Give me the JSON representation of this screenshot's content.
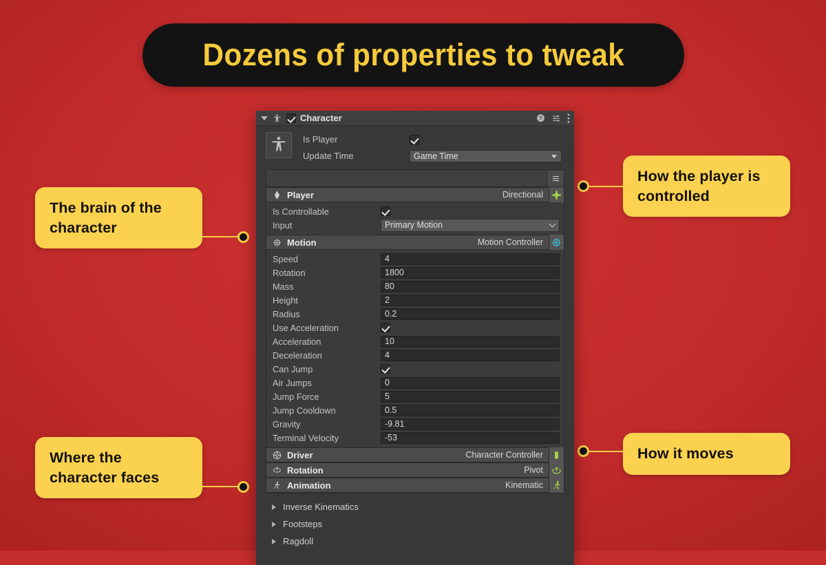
{
  "banner": {
    "title": "Dozens of properties to tweak"
  },
  "colors": {
    "background_red": "#c62d2d",
    "banner_bg": "#131313",
    "banner_text": "#f5ca3c",
    "callout_bg": "#fad24f",
    "callout_text": "#15110c",
    "leader_line": "#f8cf48",
    "panel_bg": "#383838",
    "accent_green": "#a8d14a",
    "accent_cyan": "#3fc5e0"
  },
  "callouts": [
    {
      "id": "brain",
      "text": "The brain of the character"
    },
    {
      "id": "controlled",
      "text": "How the player is controlled"
    },
    {
      "id": "faces",
      "text": "Where the character faces"
    },
    {
      "id": "moves",
      "text": "How it moves"
    }
  ],
  "inspector": {
    "header": {
      "foldout_icon": "triangle-down-icon",
      "component_icon": "character-person-icon",
      "enabled": true,
      "title": "Character",
      "icons": [
        "help-icon",
        "preset-sliders-icon",
        "more-menu-icon"
      ]
    },
    "script_thumbnail_icon": "character-person-icon",
    "top_fields": [
      {
        "label": "Is Player",
        "type": "checkbox",
        "value": true
      },
      {
        "label": "Update Time",
        "type": "dropdown",
        "value": "Game Time"
      }
    ],
    "nested_toolbar_icon": "preset-sliders-icon",
    "sections": [
      {
        "id": "player",
        "icon": "diamond-icon",
        "name": "Player",
        "value": "Directional",
        "badge_icon": "dpad-move-icon",
        "badge_color": "#a8d14a",
        "rows": [
          {
            "label": "Is Controllable",
            "type": "checkbox",
            "value": true
          },
          {
            "label": "Input",
            "type": "dropdown",
            "value": "Primary Motion"
          }
        ]
      },
      {
        "id": "motion",
        "icon": "gear-chip-icon",
        "name": "Motion",
        "value": "Motion Controller",
        "badge_icon": "gear-chip-icon",
        "badge_color": "#3fc5e0",
        "rows": [
          {
            "label": "Speed",
            "type": "text",
            "value": "4"
          },
          {
            "label": "Rotation",
            "type": "text",
            "value": "1800"
          },
          {
            "label": "Mass",
            "type": "text",
            "value": "80"
          },
          {
            "label": "Height",
            "type": "text",
            "value": "2"
          },
          {
            "label": "Radius",
            "type": "text",
            "value": "0.2"
          },
          {
            "label": "Use Acceleration",
            "type": "checkbox",
            "value": true
          },
          {
            "label": "Acceleration",
            "type": "text",
            "value": "10"
          },
          {
            "label": "Deceleration",
            "type": "text",
            "value": "4"
          },
          {
            "label": "Can Jump",
            "type": "checkbox",
            "value": true
          },
          {
            "label": "Air Jumps",
            "type": "text",
            "value": "0"
          },
          {
            "label": "Jump Force",
            "type": "text",
            "value": "5"
          },
          {
            "label": "Jump Cooldown",
            "type": "text",
            "value": "0.5"
          },
          {
            "label": "Gravity",
            "type": "text",
            "value": "-9.81"
          },
          {
            "label": "Terminal Velocity",
            "type": "text",
            "value": "-53"
          }
        ]
      },
      {
        "id": "driver",
        "icon": "wheel-icon",
        "name": "Driver",
        "value": "Character Controller",
        "badge_icon": "capsule-icon",
        "badge_color": "#a8d14a",
        "rows": []
      },
      {
        "id": "rotation",
        "icon": "rotate-icon",
        "name": "Rotation",
        "value": "Pivot",
        "badge_icon": "rotate-icon",
        "badge_color": "#a8d14a",
        "rows": []
      },
      {
        "id": "animation",
        "icon": "running-person-icon",
        "name": "Animation",
        "value": "Kinematic",
        "badge_icon": "running-person-icon",
        "badge_color": "#a8d14a",
        "rows": []
      }
    ],
    "foldouts": [
      {
        "label": "Inverse Kinematics"
      },
      {
        "label": "Footsteps"
      },
      {
        "label": "Ragdoll"
      }
    ]
  }
}
